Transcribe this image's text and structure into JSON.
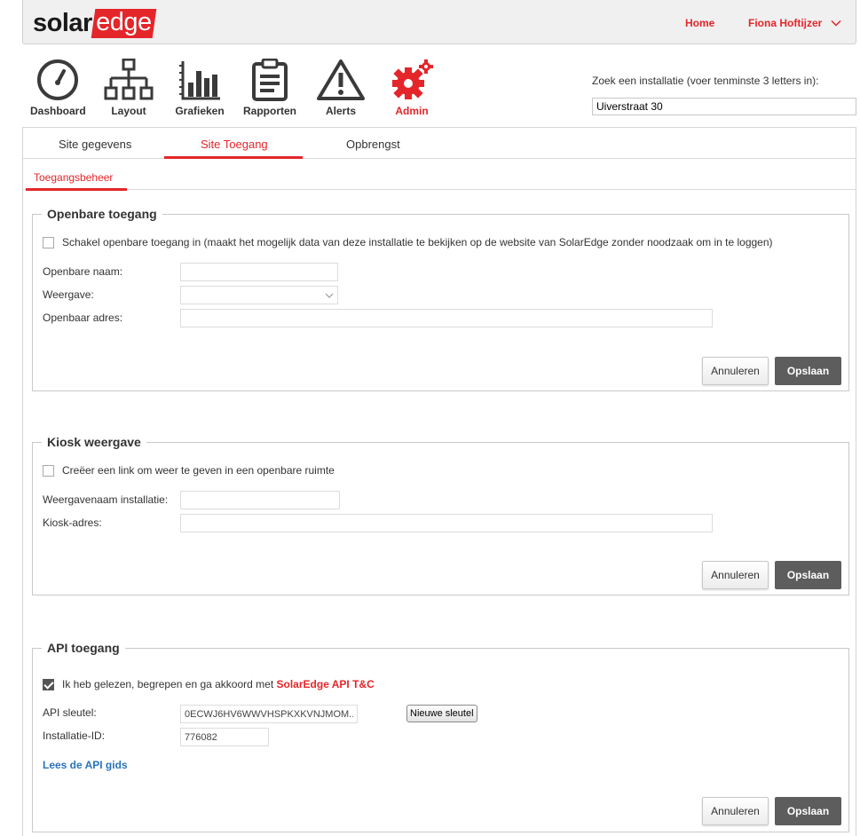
{
  "header": {
    "logo_solar": "solar",
    "logo_edge": "edge",
    "home_label": "Home",
    "user_name": "Fiona Hoftijzer"
  },
  "nav": {
    "items": [
      {
        "label": "Dashboard",
        "icon": "gauge-icon"
      },
      {
        "label": "Layout",
        "icon": "sitemap-icon"
      },
      {
        "label": "Grafieken",
        "icon": "bar-chart-icon"
      },
      {
        "label": "Rapporten",
        "icon": "clipboard-icon"
      },
      {
        "label": "Alerts",
        "icon": "warning-icon"
      },
      {
        "label": "Admin",
        "icon": "gear-icon",
        "active": true
      }
    ]
  },
  "search": {
    "label": "Zoek een installatie (voer tenminste 3 letters in):",
    "value": "Uiverstraat 30"
  },
  "tabs": [
    "Site gegevens",
    "Site Toegang",
    "Opbrengst"
  ],
  "active_tab": "Site Toegang",
  "subtab": "Toegangsbeheer",
  "public_access": {
    "title": "Openbare toegang",
    "checkbox_label": "Schakel openbare toegang in (maakt het mogelijk data van deze installatie te bekijken op de website van SolarEdge zonder noodzaak om in te loggen)",
    "checked": false,
    "name_label": "Openbare naam:",
    "name_value": "",
    "view_label": "Weergave:",
    "view_value": "",
    "address_label": "Openbaar adres:",
    "address_value": "",
    "cancel": "Annuleren",
    "save": "Opslaan"
  },
  "kiosk": {
    "title": "Kiosk weergave",
    "checkbox_label": "Creëer een link om weer te geven in een openbare ruimte",
    "checked": false,
    "name_label": "Weergavenaam installatie:",
    "name_value": "",
    "address_label": "Kiosk-adres:",
    "address_value": "",
    "cancel": "Annuleren",
    "save": "Opslaan"
  },
  "api": {
    "title": "API toegang",
    "checkbox_prefix": "Ik heb gelezen, begrepen en ga akkoord met",
    "checkbox_link": "SolarEdge API T&C",
    "checked": true,
    "key_label": "API sleutel:",
    "key_value": "0ECWJ6HV6WWVHSPKXKVNJMOM...",
    "new_key": "Nieuwe sleutel",
    "id_label": "Installatie-ID:",
    "id_value": "776082",
    "guide_link": "Lees de API gids",
    "cancel": "Annuleren",
    "save": "Opslaan"
  },
  "colors": {
    "accent": "#e4262a",
    "link_blue": "#2a73b8",
    "save_button": "#5d5d5d"
  }
}
